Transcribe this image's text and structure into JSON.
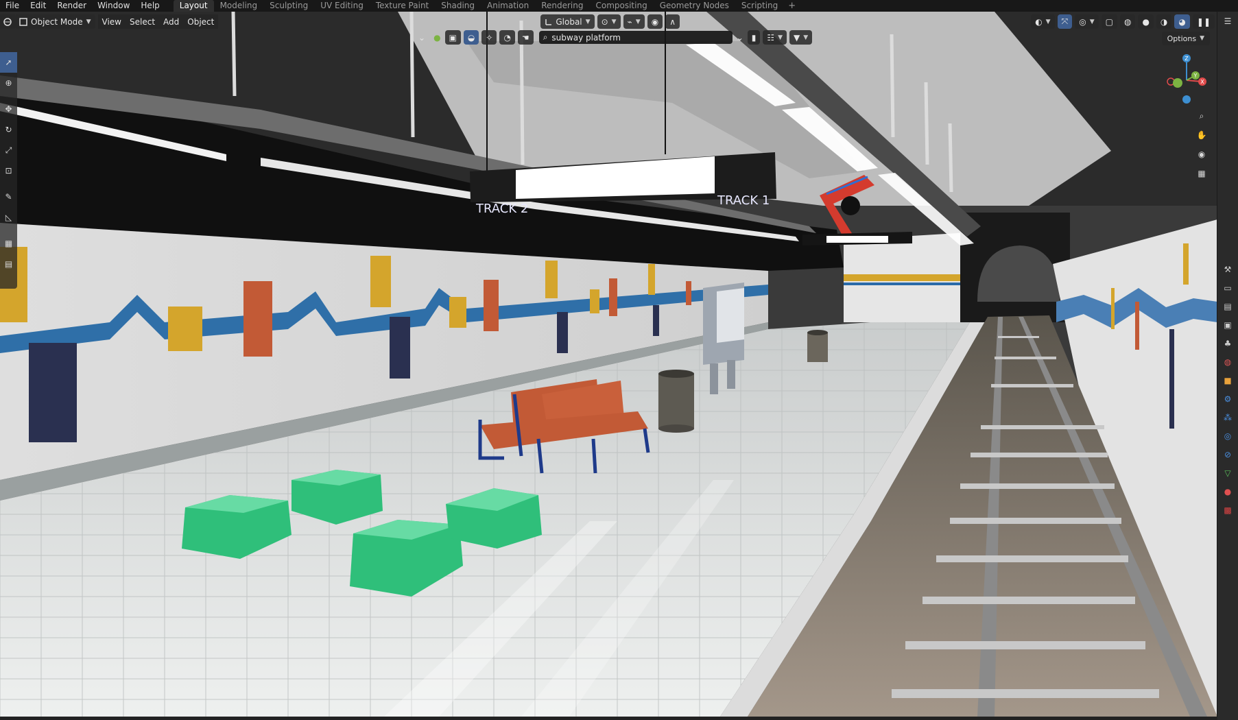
{
  "menus": [
    "File",
    "Edit",
    "Render",
    "Window",
    "Help"
  ],
  "workspaces": {
    "active": "Layout",
    "tabs": [
      "Layout",
      "Modeling",
      "Sculpting",
      "UV Editing",
      "Texture Paint",
      "Shading",
      "Animation",
      "Rendering",
      "Compositing",
      "Geometry Nodes",
      "Scripting"
    ]
  },
  "header": {
    "mode": "Object Mode",
    "view": "View",
    "select": "Select",
    "add": "Add",
    "object": "Object",
    "transform_orientation": "Global",
    "search_value": "subway platform",
    "options": "Options"
  },
  "scene": {
    "sign_left": "TRACK 2",
    "sign_right": "TRACK 1"
  },
  "gizmo": {
    "x": "X",
    "y": "Y",
    "z": "Z"
  },
  "colors": {
    "accent": "#4772b3",
    "x_axis": "#e04b4b",
    "y_axis": "#7cb342",
    "z_axis": "#3d8fd1",
    "bench": "#c25a36",
    "planter": "#2fbf7a"
  },
  "icons": {
    "toolbar": [
      "select-box-icon",
      "cursor-icon",
      "move-icon",
      "rotate-icon",
      "scale-icon",
      "transform-icon",
      "annotate-icon",
      "measure-icon",
      "add-cube-icon",
      "add-primitive-icon"
    ],
    "nav": [
      "zoom-icon",
      "pan-hand-icon",
      "camera-view-icon",
      "ortho-grid-icon"
    ],
    "properties": [
      "tool-icon",
      "render-icon",
      "output-icon",
      "view-layer-icon",
      "scene-icon",
      "world-icon",
      "object-icon",
      "modifier-icon",
      "particles-icon",
      "physics-icon",
      "constraints-icon",
      "data-icon",
      "material-icon",
      "texture-icon"
    ]
  }
}
